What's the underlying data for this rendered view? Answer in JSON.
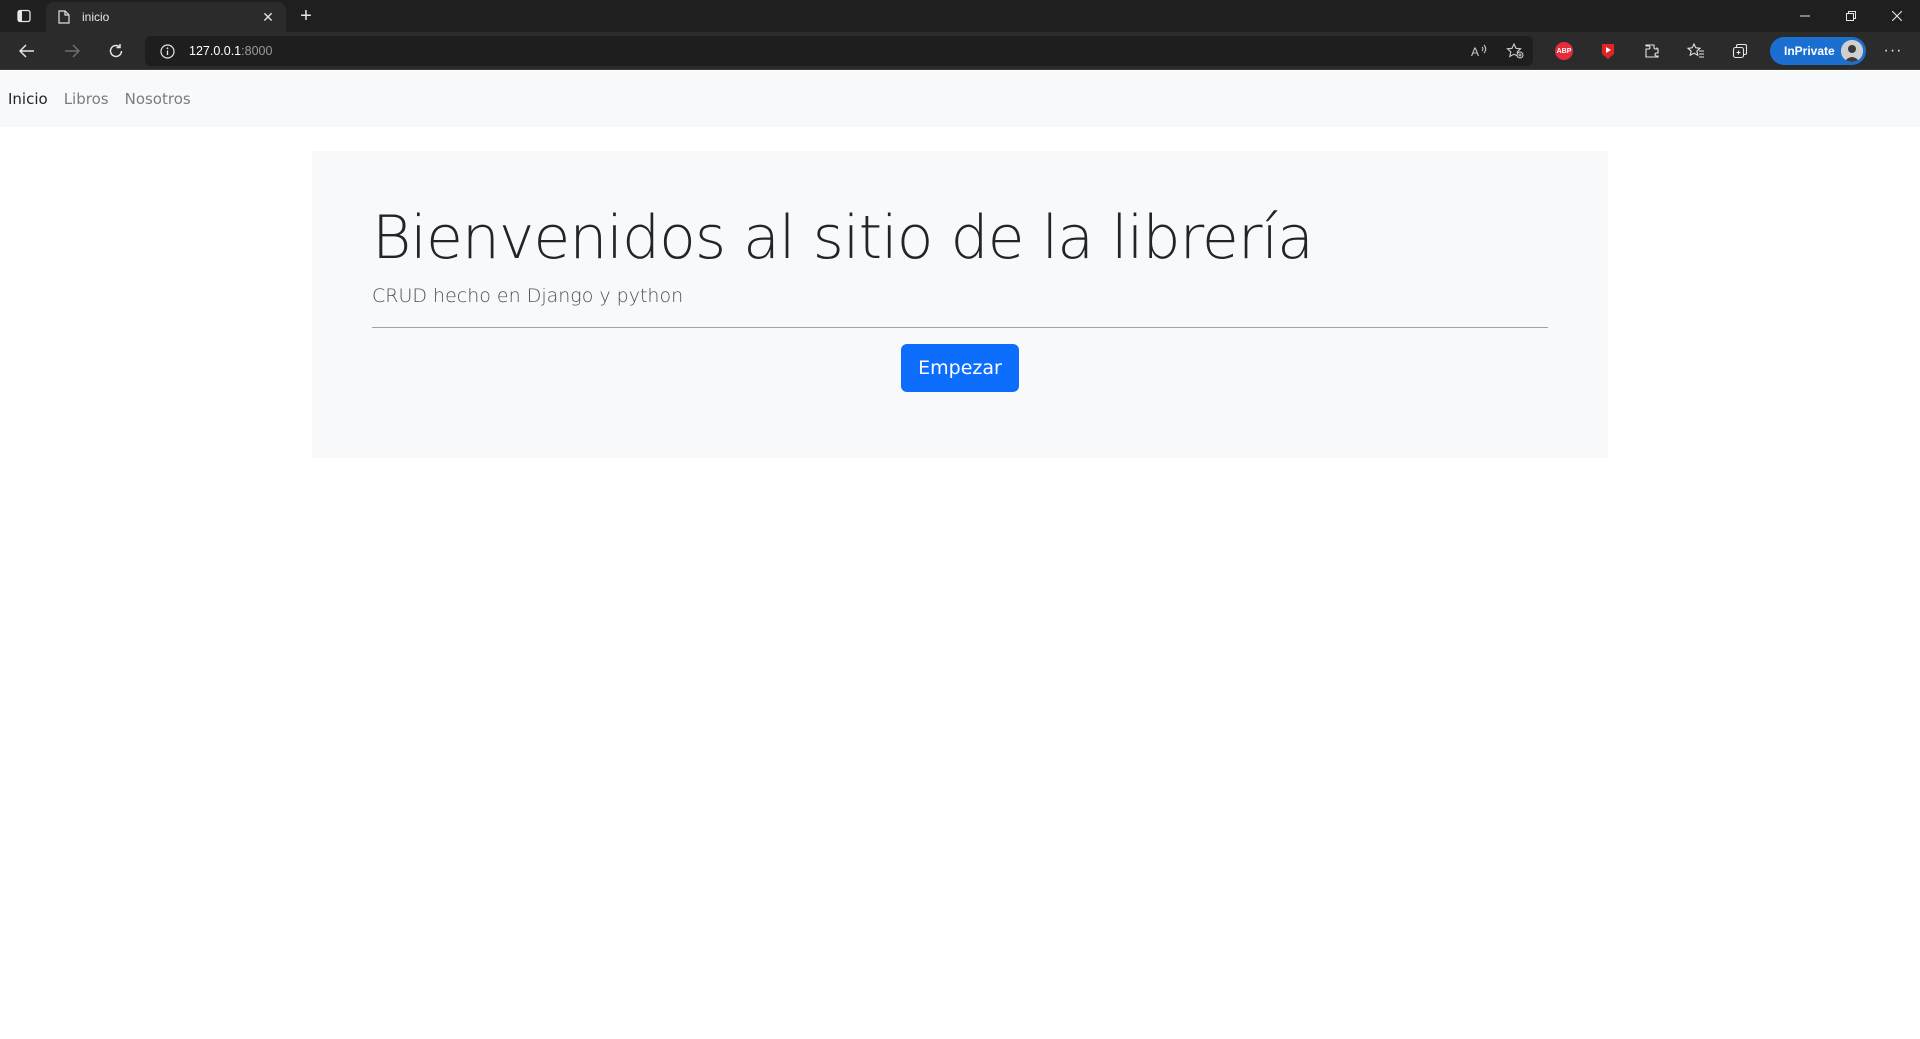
{
  "browser": {
    "tab_title": "inicio",
    "url_host": "127.0.0.1",
    "url_port": ":8000",
    "inprivate_label": "InPrivate",
    "abp_label": "ABP"
  },
  "nav": {
    "items": [
      {
        "label": "Inicio",
        "active": true
      },
      {
        "label": "Libros",
        "active": false
      },
      {
        "label": "Nosotros",
        "active": false
      }
    ]
  },
  "hero": {
    "title": "Bienvenidos al sitio de la librería",
    "subtitle": "CRUD hecho en Django y python",
    "button_label": "Empezar"
  },
  "colors": {
    "primary": "#0d6efd",
    "nav_bg": "#f8f9fa",
    "chrome_dark": "#1f1f1f",
    "inprivate": "#1a6fd1"
  }
}
